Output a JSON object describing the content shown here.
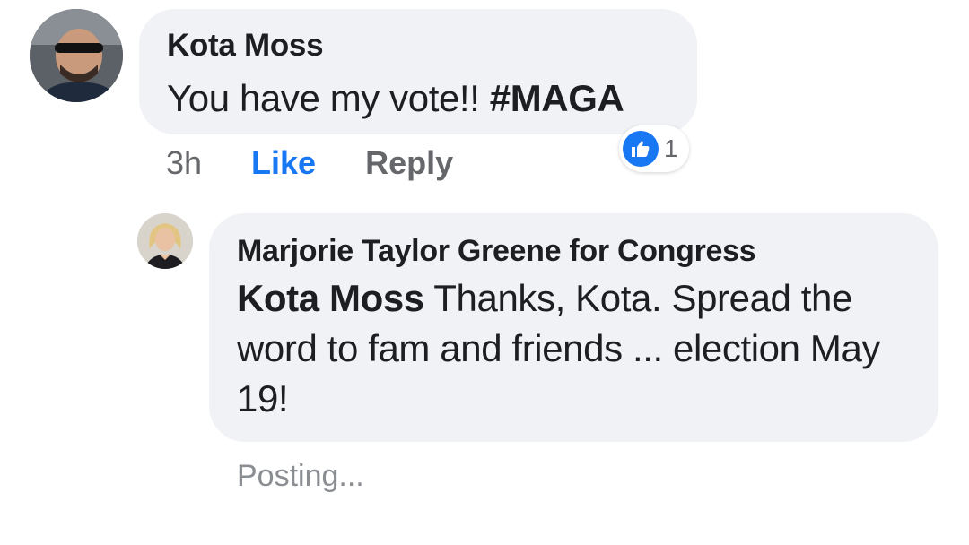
{
  "comment": {
    "author": "Kota Moss",
    "text_plain": "You have my vote!! ",
    "text_hashtag": "#MAGA",
    "time": "3h",
    "like_label": "Like",
    "reply_label": "Reply",
    "reaction_count": "1",
    "reaction_icon": "thumbs-up-icon",
    "like_color": "#1877f2"
  },
  "reply": {
    "author": "Marjorie Taylor Greene for Congress",
    "mention": "Kota Moss",
    "text": " Thanks, Kota. Spread the word to fam and friends ... election May 19!",
    "status": "Posting..."
  }
}
